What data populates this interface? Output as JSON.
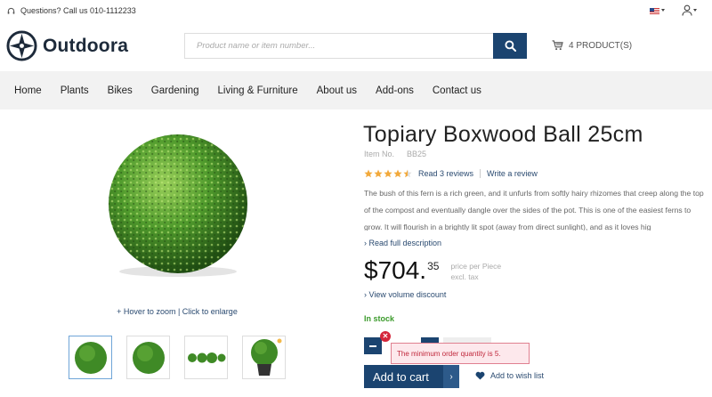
{
  "topbar": {
    "phone_text": "Questions? Call us 010-1112233",
    "language_icon": "us-flag-icon",
    "account_icon": "user-icon"
  },
  "header": {
    "logo_text": "Outdoora",
    "search_placeholder": "Product name or item number...",
    "cart_label": "4 PRODUCT(S)"
  },
  "nav": {
    "items": [
      "Home",
      "Plants",
      "Bikes",
      "Gardening",
      "Living & Furniture",
      "About us",
      "Add-ons",
      "Contact us"
    ]
  },
  "gallery": {
    "zoom_hint": "+ Hover to zoom | Click to enlarge",
    "thumbnail_count": 4
  },
  "product": {
    "title": "Topiary Boxwood Ball 25cm",
    "item_no_label": "Item No.",
    "item_no": "BB25",
    "rating_stars": 4.5,
    "rating_max": 5,
    "reviews_link": "Read 3 reviews",
    "write_review": "Write a review",
    "description": "The bush of this fern is a rich green, and it unfurls from softly hairy rhizomes that creep along the top of the compost and eventually dangle over the sides of the pot. This is one of the easiest ferns to grow. It will flourish in a brightly lit spot (away from direct sunlight), and as it loves hig",
    "read_more": "› Read full description",
    "price_main": "$704.",
    "price_cents": "35",
    "price_unit": "price per Piece",
    "price_tax": "excl. tax",
    "volume_discount": "› View volume discount",
    "stock": "In stock",
    "quantity_error": "The minimum order quantity is 5.",
    "add_to_cart": "Add to cart",
    "add_to_wishlist": "Add to wish list"
  },
  "colors": {
    "primary": "#1b4470",
    "link": "#2a4a70",
    "stock": "#3a9a2a",
    "error": "#d4263a",
    "star": "#f2a93b"
  }
}
